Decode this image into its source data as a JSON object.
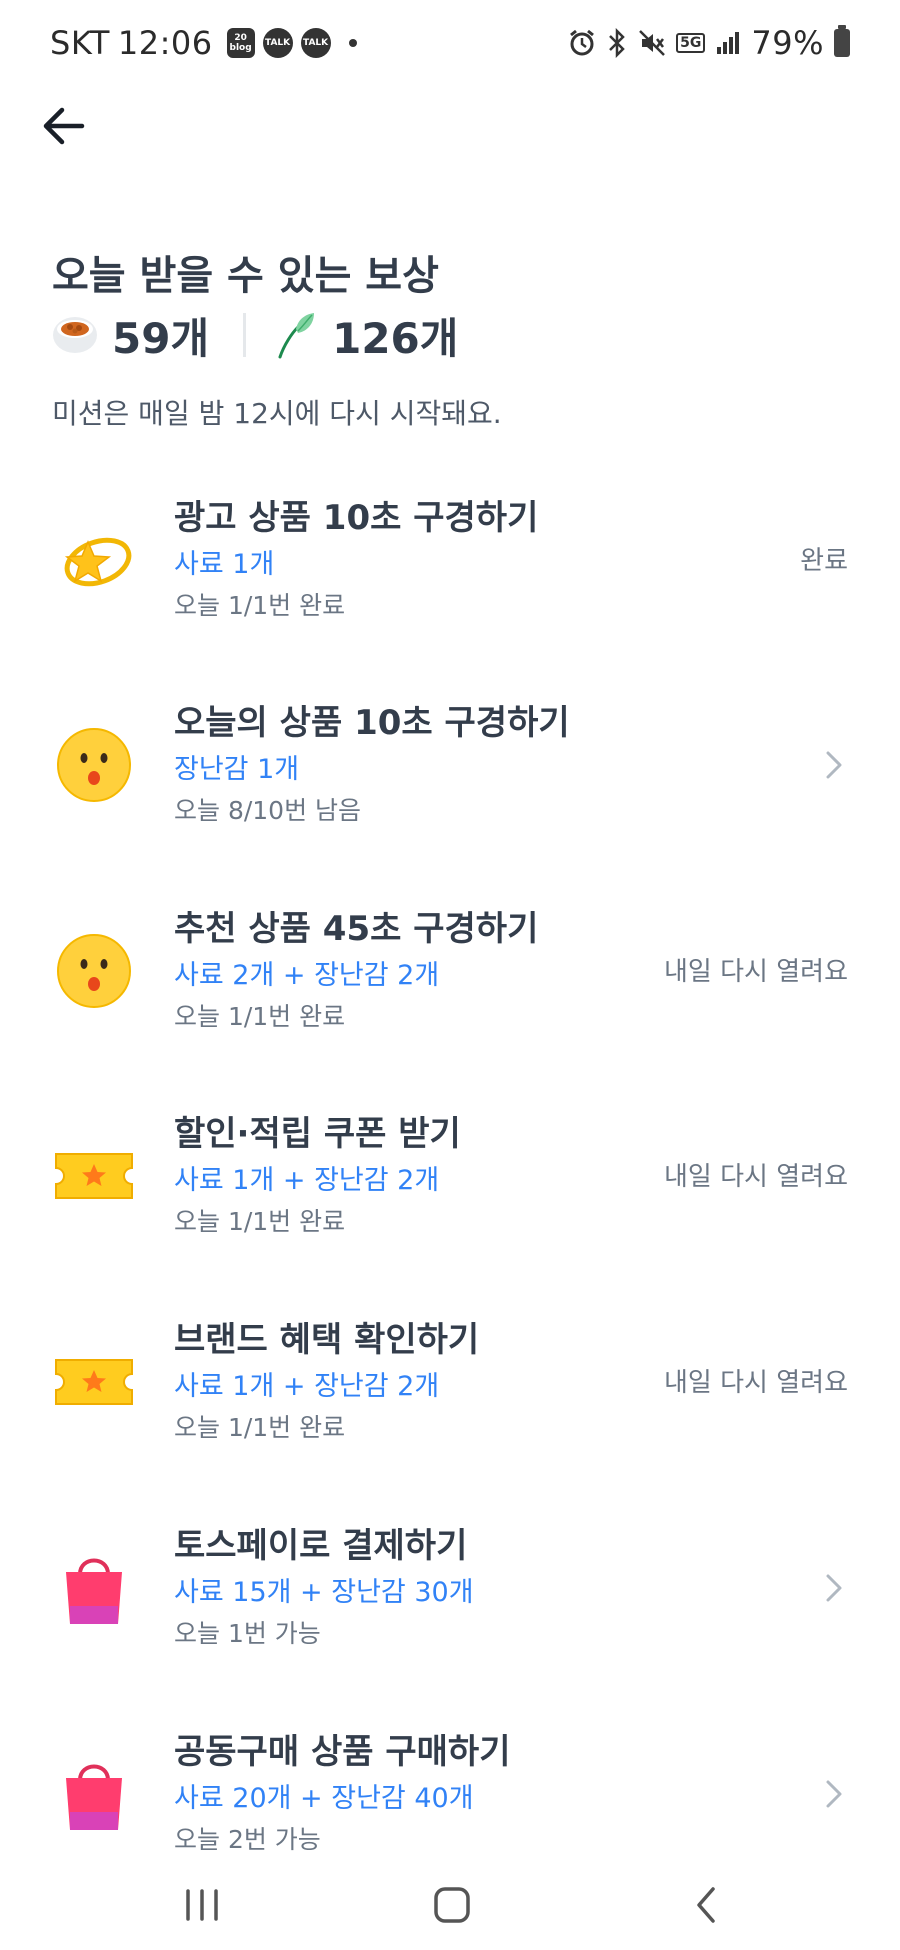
{
  "status_bar": {
    "carrier": "SKT",
    "time": "12:06",
    "notif_icons": [
      "20 blog",
      "TALK",
      "TALK"
    ],
    "network": "5G",
    "battery": "79%"
  },
  "header": {
    "title": "오늘 받을 수 있는 보상",
    "food_total": "59개",
    "toy_total": "126개",
    "subtitle": "미션은 매일 밤 12시에 다시 시작돼요."
  },
  "missions": [
    {
      "icon": "star-icon",
      "title": "광고 상품 10초 구경하기",
      "reward": "사료 1개",
      "progress": "오늘 1/1번 완료",
      "status": "완료",
      "chevron": false
    },
    {
      "icon": "surprised-face-icon",
      "title": "오늘의 상품 10초 구경하기",
      "reward": "장난감 1개",
      "progress": "오늘 8/10번 남음",
      "status": "",
      "chevron": true
    },
    {
      "icon": "surprised-face-icon",
      "title": "추천 상품 45초 구경하기",
      "reward": "사료 2개 + 장난감 2개",
      "progress": "오늘 1/1번 완료",
      "status": "내일 다시 열려요",
      "chevron": false
    },
    {
      "icon": "ticket-icon",
      "title": "할인·적립 쿠폰 받기",
      "reward": "사료 1개 + 장난감 2개",
      "progress": "오늘 1/1번 완료",
      "status": "내일 다시 열려요",
      "chevron": false
    },
    {
      "icon": "ticket-icon",
      "title": "브랜드 혜택 확인하기",
      "reward": "사료 1개 + 장난감 2개",
      "progress": "오늘 1/1번 완료",
      "status": "내일 다시 열려요",
      "chevron": false
    },
    {
      "icon": "shopping-bag-icon",
      "title": "토스페이로 결제하기",
      "reward": "사료 15개 + 장난감 30개",
      "progress": "오늘 1번 가능",
      "status": "",
      "chevron": true
    },
    {
      "icon": "shopping-bag-icon",
      "title": "공동구매 상품 구매하기",
      "reward": "사료 20개 + 장난감 40개",
      "progress": "오늘 2번 가능",
      "status": "",
      "chevron": true
    }
  ],
  "colors": {
    "accent": "#3182f6",
    "title_text": "#333d4b",
    "secondary_text": "#6b7684"
  }
}
